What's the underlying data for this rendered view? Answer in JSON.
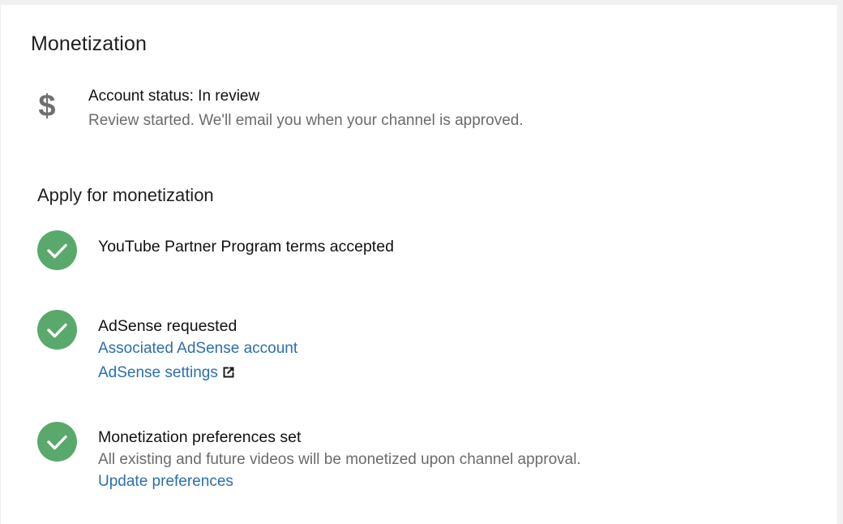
{
  "page": {
    "title": "Monetization"
  },
  "account_status": {
    "icon": "dollar-icon",
    "icon_glyph": "$",
    "title": "Account status: In review",
    "description": "Review started. We'll email you when your channel is approved."
  },
  "apply": {
    "title": "Apply for monetization",
    "steps": [
      {
        "icon": "check-circle-icon",
        "title": "YouTube Partner Program terms accepted"
      },
      {
        "icon": "check-circle-icon",
        "title": "AdSense requested",
        "links": [
          {
            "label": "Associated AdSense account"
          },
          {
            "label": "AdSense settings",
            "icon": "external-link-icon"
          }
        ]
      },
      {
        "icon": "check-circle-icon",
        "title": "Monetization preferences set",
        "description": "All existing and future videos will be monetized upon channel approval.",
        "links": [
          {
            "label": "Update preferences"
          }
        ]
      }
    ]
  },
  "colors": {
    "check_green": "#5aa96c",
    "link_blue": "#2a6fb0",
    "muted_text": "#6b6b6b"
  }
}
